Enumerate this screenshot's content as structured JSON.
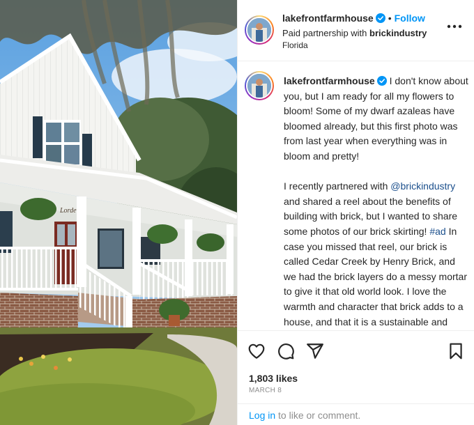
{
  "post": {
    "username": "lakefrontfarmhouse",
    "follow_label": "Follow",
    "dot": "•",
    "paid_partnership_prefix": "Paid partnership with",
    "partner": "brickindustry",
    "location": "Florida",
    "photo_sign_text": "Lorde"
  },
  "caption": {
    "username": "lakefrontfarmhouse",
    "para1": "I don't know about you, but I am ready for all my flowers to bloom! Some of my dwarf azaleas have bloomed already, but this first photo was from last year when everything was in bloom and pretty!",
    "para2_pre": "I recently partnered with",
    "mention": "@brickindustry",
    "para2_mid": "and shared a reel about the benefits of building with brick, but I wanted to share some photos of our brick skirting!",
    "hashtag": "#ad",
    "para2_post": "In case you missed that reel, our brick is called Cedar Creek by Henry Brick, and we had the brick layers do a messy mortar to give it that old world look. I love the warmth and character that brick adds to a house, and that it is a sustainable and durable choice"
  },
  "engagement": {
    "likes": "1,803 likes",
    "date": "MARCH 8"
  },
  "footer": {
    "login_link": "Log in",
    "login_rest": "to like or comment."
  },
  "icons": {
    "like": "heart-icon",
    "comment": "comment-icon",
    "share": "share-icon",
    "save": "bookmark-icon",
    "more": "more-options-icon",
    "verified": "verified-badge-icon"
  },
  "colors": {
    "link_blue": "#0095f6",
    "mention_blue": "#1b4f8c",
    "verified_blue": "#0095f6",
    "muted": "#8e8e8e"
  }
}
